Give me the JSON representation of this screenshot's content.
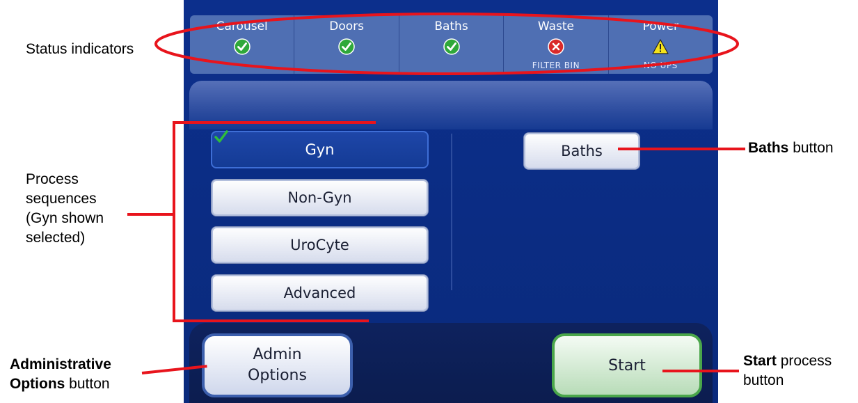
{
  "annotations": {
    "status_indicators": "Status indicators",
    "process_sequences": [
      "Process",
      "sequences",
      "(Gyn shown",
      "selected)"
    ],
    "baths_bold": "Baths",
    "baths_rest": " button",
    "admin_bold_1": "Administrative",
    "admin_bold_2": "Options",
    "admin_rest": " button",
    "start_bold": "Start",
    "start_rest_1": " process",
    "start_rest_2": "button"
  },
  "status_bar": [
    {
      "name": "Carousel",
      "icon": "check-icon",
      "sub": ""
    },
    {
      "name": "Doors",
      "icon": "check-icon",
      "sub": ""
    },
    {
      "name": "Baths",
      "icon": "check-icon",
      "sub": ""
    },
    {
      "name": "Waste",
      "icon": "error-icon",
      "sub": "FILTER BIN"
    },
    {
      "name": "Power",
      "icon": "warning-icon",
      "sub": "NO UPS"
    }
  ],
  "sequences": [
    {
      "label": "Gyn",
      "selected": true
    },
    {
      "label": "Non-Gyn",
      "selected": false
    },
    {
      "label": "UroCyte",
      "selected": false
    },
    {
      "label": "Advanced",
      "selected": false
    }
  ],
  "baths_button": "Baths",
  "admin_button": [
    "Admin",
    "Options"
  ],
  "start_button": "Start",
  "colors": {
    "annotation_red": "#e8141c",
    "screen_blue": "#0b2d86",
    "ok_green": "#2fa83a",
    "error_red": "#d92a2a",
    "warning_yellow": "#f4e21a"
  }
}
